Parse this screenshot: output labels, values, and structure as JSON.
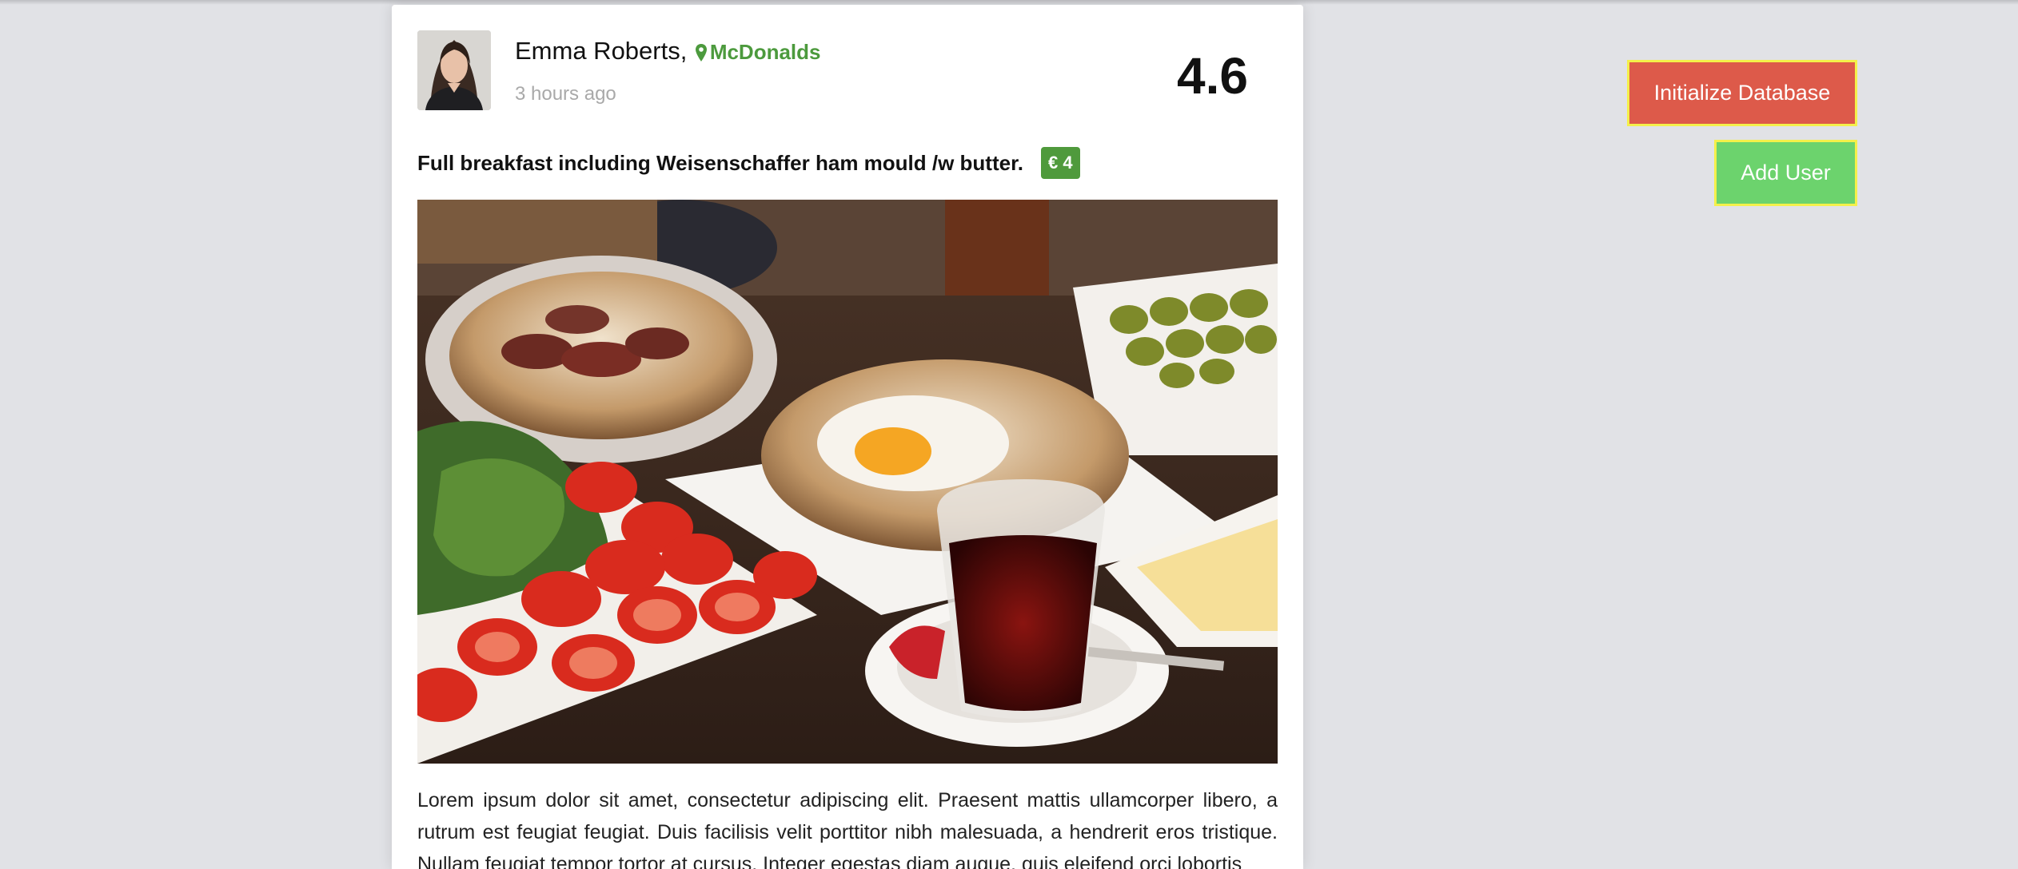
{
  "post": {
    "author": "Emma Roberts",
    "comma": ",",
    "location": "McDonalds",
    "timestamp": "3 hours ago",
    "rating": "4.6",
    "title": "Full breakfast including Weisenschaffer ham mould /w butter.",
    "price": "€ 4",
    "body": "Lorem ipsum dolor sit amet, consectetur adipiscing elit. Praesent mattis ullamcorper libero, a rutrum est feugiat feugiat. Duis facilisis velit porttitor nibh malesuada, a hendrerit eros tristique. Nullam feugiat tempor tortor at cursus. Integer egestas diam augue, quis eleifend orci lobortis"
  },
  "actions": {
    "init_db_label": "Initialize Database",
    "add_user_label": "Add User"
  },
  "icons": {
    "location": "map-marker-icon"
  },
  "colors": {
    "location_green": "#4c9a3d",
    "price_badge": "#4f9a3c",
    "init_button": "#dd5a4a",
    "add_button": "#6cd36d",
    "button_border": "#f4f04a"
  }
}
